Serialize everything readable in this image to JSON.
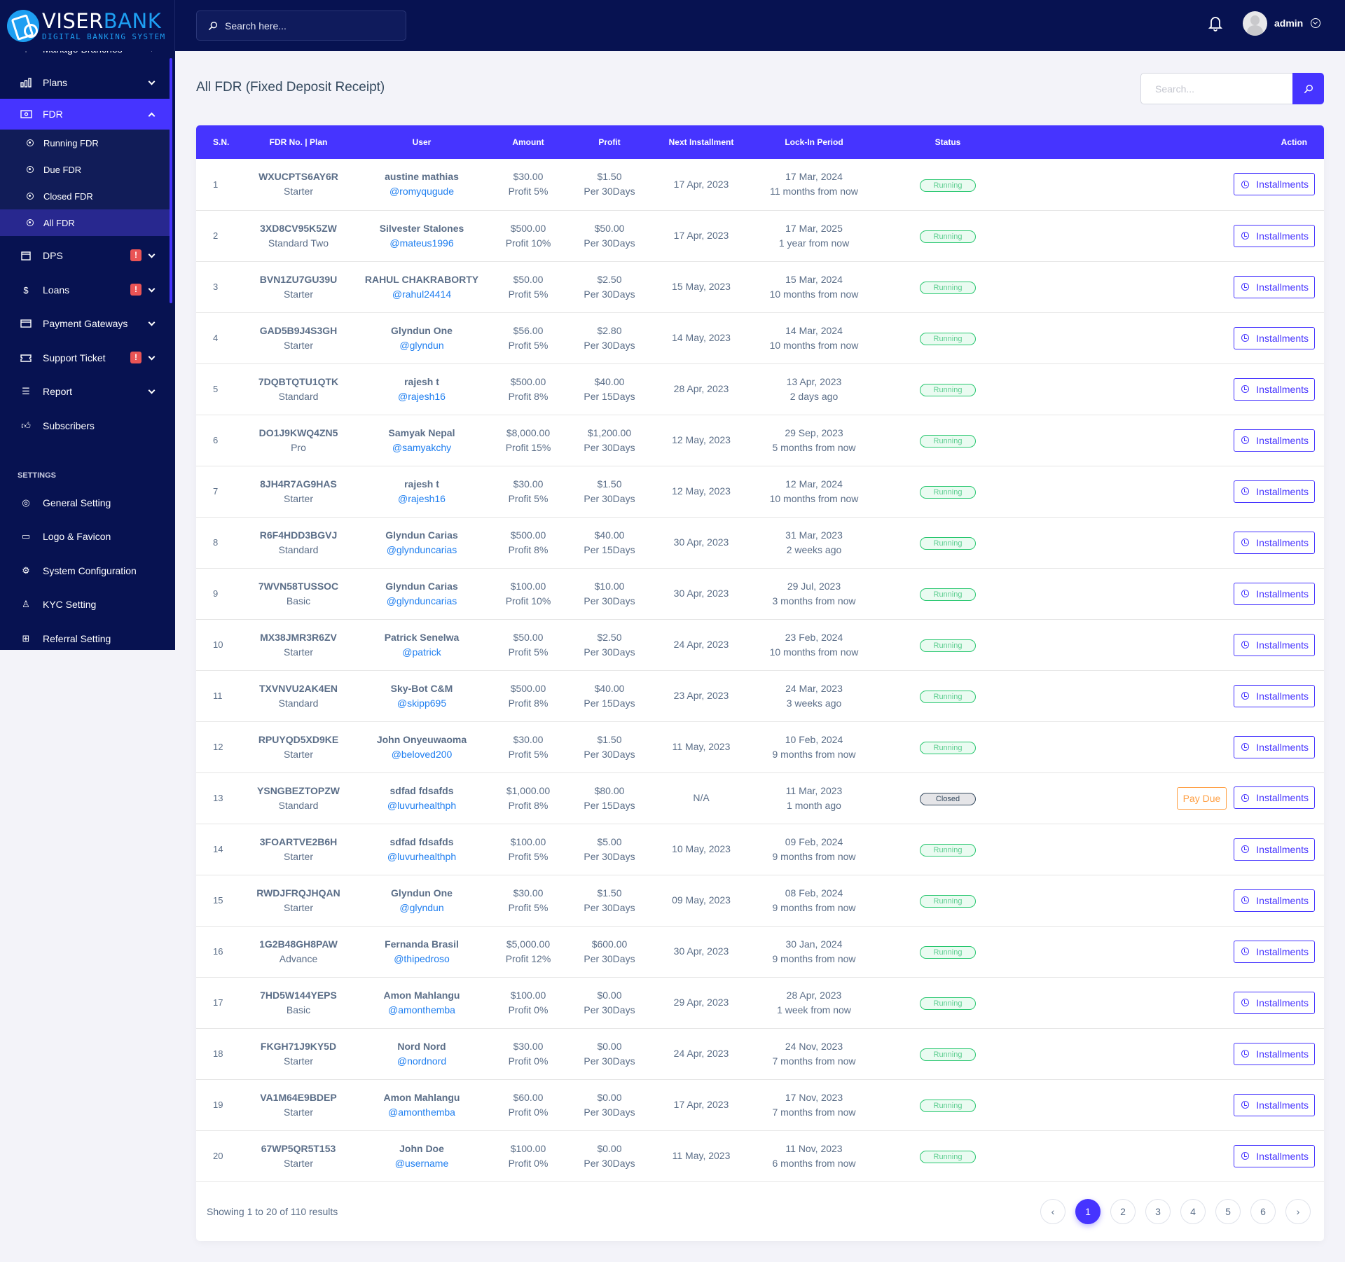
{
  "brand": {
    "name_part1": "VISER",
    "name_part2": "BANK",
    "tagline": "DIGITAL BANKING SYSTEM"
  },
  "topbar": {
    "search_placeholder": "Search here...",
    "user_name": "admin"
  },
  "sidebar": {
    "items": [
      {
        "label": "Manage Branches",
        "icon": "branch-icon",
        "chevron": "down"
      },
      {
        "label": "Plans",
        "icon": "chart-bar-icon",
        "chevron": "down"
      },
      {
        "label": "FDR",
        "icon": "money-icon",
        "chevron": "up",
        "active": true
      },
      {
        "label": "DPS",
        "icon": "box-icon",
        "chevron": "down",
        "badge": "!"
      },
      {
        "label": "Loans",
        "icon": "hand-dollar-icon",
        "chevron": "down",
        "badge": "!"
      },
      {
        "label": "Payment Gateways",
        "icon": "credit-card-icon",
        "chevron": "down"
      },
      {
        "label": "Support Ticket",
        "icon": "ticket-icon",
        "chevron": "down",
        "badge": "!"
      },
      {
        "label": "Report",
        "icon": "list-icon",
        "chevron": "down"
      },
      {
        "label": "Subscribers",
        "icon": "thumbs-up-icon"
      }
    ],
    "fdr_sub": [
      {
        "label": "Running FDR"
      },
      {
        "label": "Due FDR"
      },
      {
        "label": "Closed FDR"
      },
      {
        "label": "All FDR",
        "active": true
      }
    ],
    "settings_title": "SETTINGS",
    "settings": [
      {
        "label": "General Setting",
        "icon": "life-ring-icon"
      },
      {
        "label": "Logo & Favicon",
        "icon": "images-icon"
      },
      {
        "label": "System Configuration",
        "icon": "gear-icon"
      },
      {
        "label": "KYC Setting",
        "icon": "user-check-icon"
      },
      {
        "label": "Referral Setting",
        "icon": "sitemap-icon"
      }
    ]
  },
  "page": {
    "title": "All FDR (Fixed Deposit Receipt)",
    "search_placeholder": "Search..."
  },
  "table": {
    "headers": [
      "S.N.",
      "FDR No. | Plan",
      "User",
      "Amount",
      "Profit",
      "Next Installment",
      "Lock-In Period",
      "Status",
      "Action"
    ],
    "installments_label": "Installments",
    "pay_due_label": "Pay Due",
    "rows": [
      {
        "sn": "1",
        "fdr": "WXUCPTS6AY6R",
        "plan": "Starter",
        "name": "austine mathias",
        "username": "@romyqugude",
        "amount": "$30.00",
        "amount_sub": "Profit 5%",
        "profit": "$1.50",
        "profit_sub": "Per 30Days",
        "next": "17 Apr, 2023",
        "lock": "17 Mar, 2024",
        "lock_sub": "11 months from now",
        "status": "Running"
      },
      {
        "sn": "2",
        "fdr": "3XD8CV95K5ZW",
        "plan": "Standard Two",
        "name": "Silvester Stalones",
        "username": "@mateus1996",
        "amount": "$500.00",
        "amount_sub": "Profit 10%",
        "profit": "$50.00",
        "profit_sub": "Per 30Days",
        "next": "17 Apr, 2023",
        "lock": "17 Mar, 2025",
        "lock_sub": "1 year from now",
        "status": "Running"
      },
      {
        "sn": "3",
        "fdr": "BVN1ZU7GU39U",
        "plan": "Starter",
        "name": "RAHUL CHAKRABORTY",
        "username": "@rahul24414",
        "amount": "$50.00",
        "amount_sub": "Profit 5%",
        "profit": "$2.50",
        "profit_sub": "Per 30Days",
        "next": "15 May, 2023",
        "lock": "15 Mar, 2024",
        "lock_sub": "10 months from now",
        "status": "Running"
      },
      {
        "sn": "4",
        "fdr": "GAD5B9J4S3GH",
        "plan": "Starter",
        "name": "Glyndun One",
        "username": "@glyndun",
        "amount": "$56.00",
        "amount_sub": "Profit 5%",
        "profit": "$2.80",
        "profit_sub": "Per 30Days",
        "next": "14 May, 2023",
        "lock": "14 Mar, 2024",
        "lock_sub": "10 months from now",
        "status": "Running"
      },
      {
        "sn": "5",
        "fdr": "7DQBTQTU1QTK",
        "plan": "Standard",
        "name": "rajesh t",
        "username": "@rajesh16",
        "amount": "$500.00",
        "amount_sub": "Profit 8%",
        "profit": "$40.00",
        "profit_sub": "Per 15Days",
        "next": "28 Apr, 2023",
        "lock": "13 Apr, 2023",
        "lock_sub": "2 days ago",
        "status": "Running"
      },
      {
        "sn": "6",
        "fdr": "DO1J9KWQ4ZN5",
        "plan": "Pro",
        "name": "Samyak Nepal",
        "username": "@samyakchy",
        "amount": "$8,000.00",
        "amount_sub": "Profit 15%",
        "profit": "$1,200.00",
        "profit_sub": "Per 30Days",
        "next": "12 May, 2023",
        "lock": "29 Sep, 2023",
        "lock_sub": "5 months from now",
        "status": "Running"
      },
      {
        "sn": "7",
        "fdr": "8JH4R7AG9HAS",
        "plan": "Starter",
        "name": "rajesh t",
        "username": "@rajesh16",
        "amount": "$30.00",
        "amount_sub": "Profit 5%",
        "profit": "$1.50",
        "profit_sub": "Per 30Days",
        "next": "12 May, 2023",
        "lock": "12 Mar, 2024",
        "lock_sub": "10 months from now",
        "status": "Running"
      },
      {
        "sn": "8",
        "fdr": "R6F4HDD3BGVJ",
        "plan": "Standard",
        "name": "Glyndun Carias",
        "username": "@glynduncarias",
        "amount": "$500.00",
        "amount_sub": "Profit 8%",
        "profit": "$40.00",
        "profit_sub": "Per 15Days",
        "next": "30 Apr, 2023",
        "lock": "31 Mar, 2023",
        "lock_sub": "2 weeks ago",
        "status": "Running"
      },
      {
        "sn": "9",
        "fdr": "7WVN58TUSSOC",
        "plan": "Basic",
        "name": "Glyndun Carias",
        "username": "@glynduncarias",
        "amount": "$100.00",
        "amount_sub": "Profit 10%",
        "profit": "$10.00",
        "profit_sub": "Per 30Days",
        "next": "30 Apr, 2023",
        "lock": "29 Jul, 2023",
        "lock_sub": "3 months from now",
        "status": "Running"
      },
      {
        "sn": "10",
        "fdr": "MX38JMR3R6ZV",
        "plan": "Starter",
        "name": "Patrick Senelwa",
        "username": "@patrick",
        "amount": "$50.00",
        "amount_sub": "Profit 5%",
        "profit": "$2.50",
        "profit_sub": "Per 30Days",
        "next": "24 Apr, 2023",
        "lock": "23 Feb, 2024",
        "lock_sub": "10 months from now",
        "status": "Running"
      },
      {
        "sn": "11",
        "fdr": "TXVNVU2AK4EN",
        "plan": "Standard",
        "name": "Sky-Bot C&M",
        "username": "@skipp695",
        "amount": "$500.00",
        "amount_sub": "Profit 8%",
        "profit": "$40.00",
        "profit_sub": "Per 15Days",
        "next": "23 Apr, 2023",
        "lock": "24 Mar, 2023",
        "lock_sub": "3 weeks ago",
        "status": "Running"
      },
      {
        "sn": "12",
        "fdr": "RPUYQD5XD9KE",
        "plan": "Starter",
        "name": "John Onyeuwaoma",
        "username": "@beloved200",
        "amount": "$30.00",
        "amount_sub": "Profit 5%",
        "profit": "$1.50",
        "profit_sub": "Per 30Days",
        "next": "11 May, 2023",
        "lock": "10 Feb, 2024",
        "lock_sub": "9 months from now",
        "status": "Running"
      },
      {
        "sn": "13",
        "fdr": "YSNGBEZTOPZW",
        "plan": "Standard",
        "name": "sdfad fdsafds",
        "username": "@luvurhealthph",
        "amount": "$1,000.00",
        "amount_sub": "Profit 8%",
        "profit": "$80.00",
        "profit_sub": "Per 15Days",
        "next": "N/A",
        "lock": "11 Mar, 2023",
        "lock_sub": "1 month ago",
        "status": "Closed",
        "pay_due": true
      },
      {
        "sn": "14",
        "fdr": "3FOARTVE2B6H",
        "plan": "Starter",
        "name": "sdfad fdsafds",
        "username": "@luvurhealthph",
        "amount": "$100.00",
        "amount_sub": "Profit 5%",
        "profit": "$5.00",
        "profit_sub": "Per 30Days",
        "next": "10 May, 2023",
        "lock": "09 Feb, 2024",
        "lock_sub": "9 months from now",
        "status": "Running"
      },
      {
        "sn": "15",
        "fdr": "RWDJFRQJHQAN",
        "plan": "Starter",
        "name": "Glyndun One",
        "username": "@glyndun",
        "amount": "$30.00",
        "amount_sub": "Profit 5%",
        "profit": "$1.50",
        "profit_sub": "Per 30Days",
        "next": "09 May, 2023",
        "lock": "08 Feb, 2024",
        "lock_sub": "9 months from now",
        "status": "Running"
      },
      {
        "sn": "16",
        "fdr": "1G2B48GH8PAW",
        "plan": "Advance",
        "name": "Fernanda Brasil",
        "username": "@thipedroso",
        "amount": "$5,000.00",
        "amount_sub": "Profit 12%",
        "profit": "$600.00",
        "profit_sub": "Per 30Days",
        "next": "30 Apr, 2023",
        "lock": "30 Jan, 2024",
        "lock_sub": "9 months from now",
        "status": "Running"
      },
      {
        "sn": "17",
        "fdr": "7HD5W144YEPS",
        "plan": "Basic",
        "name": "Amon Mahlangu",
        "username": "@amonthemba",
        "amount": "$100.00",
        "amount_sub": "Profit 0%",
        "profit": "$0.00",
        "profit_sub": "Per 30Days",
        "next": "29 Apr, 2023",
        "lock": "28 Apr, 2023",
        "lock_sub": "1 week from now",
        "status": "Running"
      },
      {
        "sn": "18",
        "fdr": "FKGH71J9KY5D",
        "plan": "Starter",
        "name": "Nord Nord",
        "username": "@nordnord",
        "amount": "$30.00",
        "amount_sub": "Profit 0%",
        "profit": "$0.00",
        "profit_sub": "Per 30Days",
        "next": "24 Apr, 2023",
        "lock": "24 Nov, 2023",
        "lock_sub": "7 months from now",
        "status": "Running"
      },
      {
        "sn": "19",
        "fdr": "VA1M64E9BDEP",
        "plan": "Starter",
        "name": "Amon Mahlangu",
        "username": "@amonthemba",
        "amount": "$60.00",
        "amount_sub": "Profit 0%",
        "profit": "$0.00",
        "profit_sub": "Per 30Days",
        "next": "17 Apr, 2023",
        "lock": "17 Nov, 2023",
        "lock_sub": "7 months from now",
        "status": "Running"
      },
      {
        "sn": "20",
        "fdr": "67WP5QR5T153",
        "plan": "Starter",
        "name": "John Doe",
        "username": "@username",
        "amount": "$100.00",
        "amount_sub": "Profit 0%",
        "profit": "$0.00",
        "profit_sub": "Per 30Days",
        "next": "11 May, 2023",
        "lock": "11 Nov, 2023",
        "lock_sub": "6 months from now",
        "status": "Running"
      }
    ]
  },
  "pagination": {
    "summary": "Showing 1 to 20 of 110 results",
    "prev": "‹",
    "next": "›",
    "pages": [
      "1",
      "2",
      "3",
      "4",
      "5",
      "6"
    ],
    "current": "1"
  },
  "colors": {
    "primary": "#4634ff",
    "navy": "#071251",
    "success": "#28c76f",
    "warning": "#ff9f43",
    "danger": "#ea5455"
  }
}
